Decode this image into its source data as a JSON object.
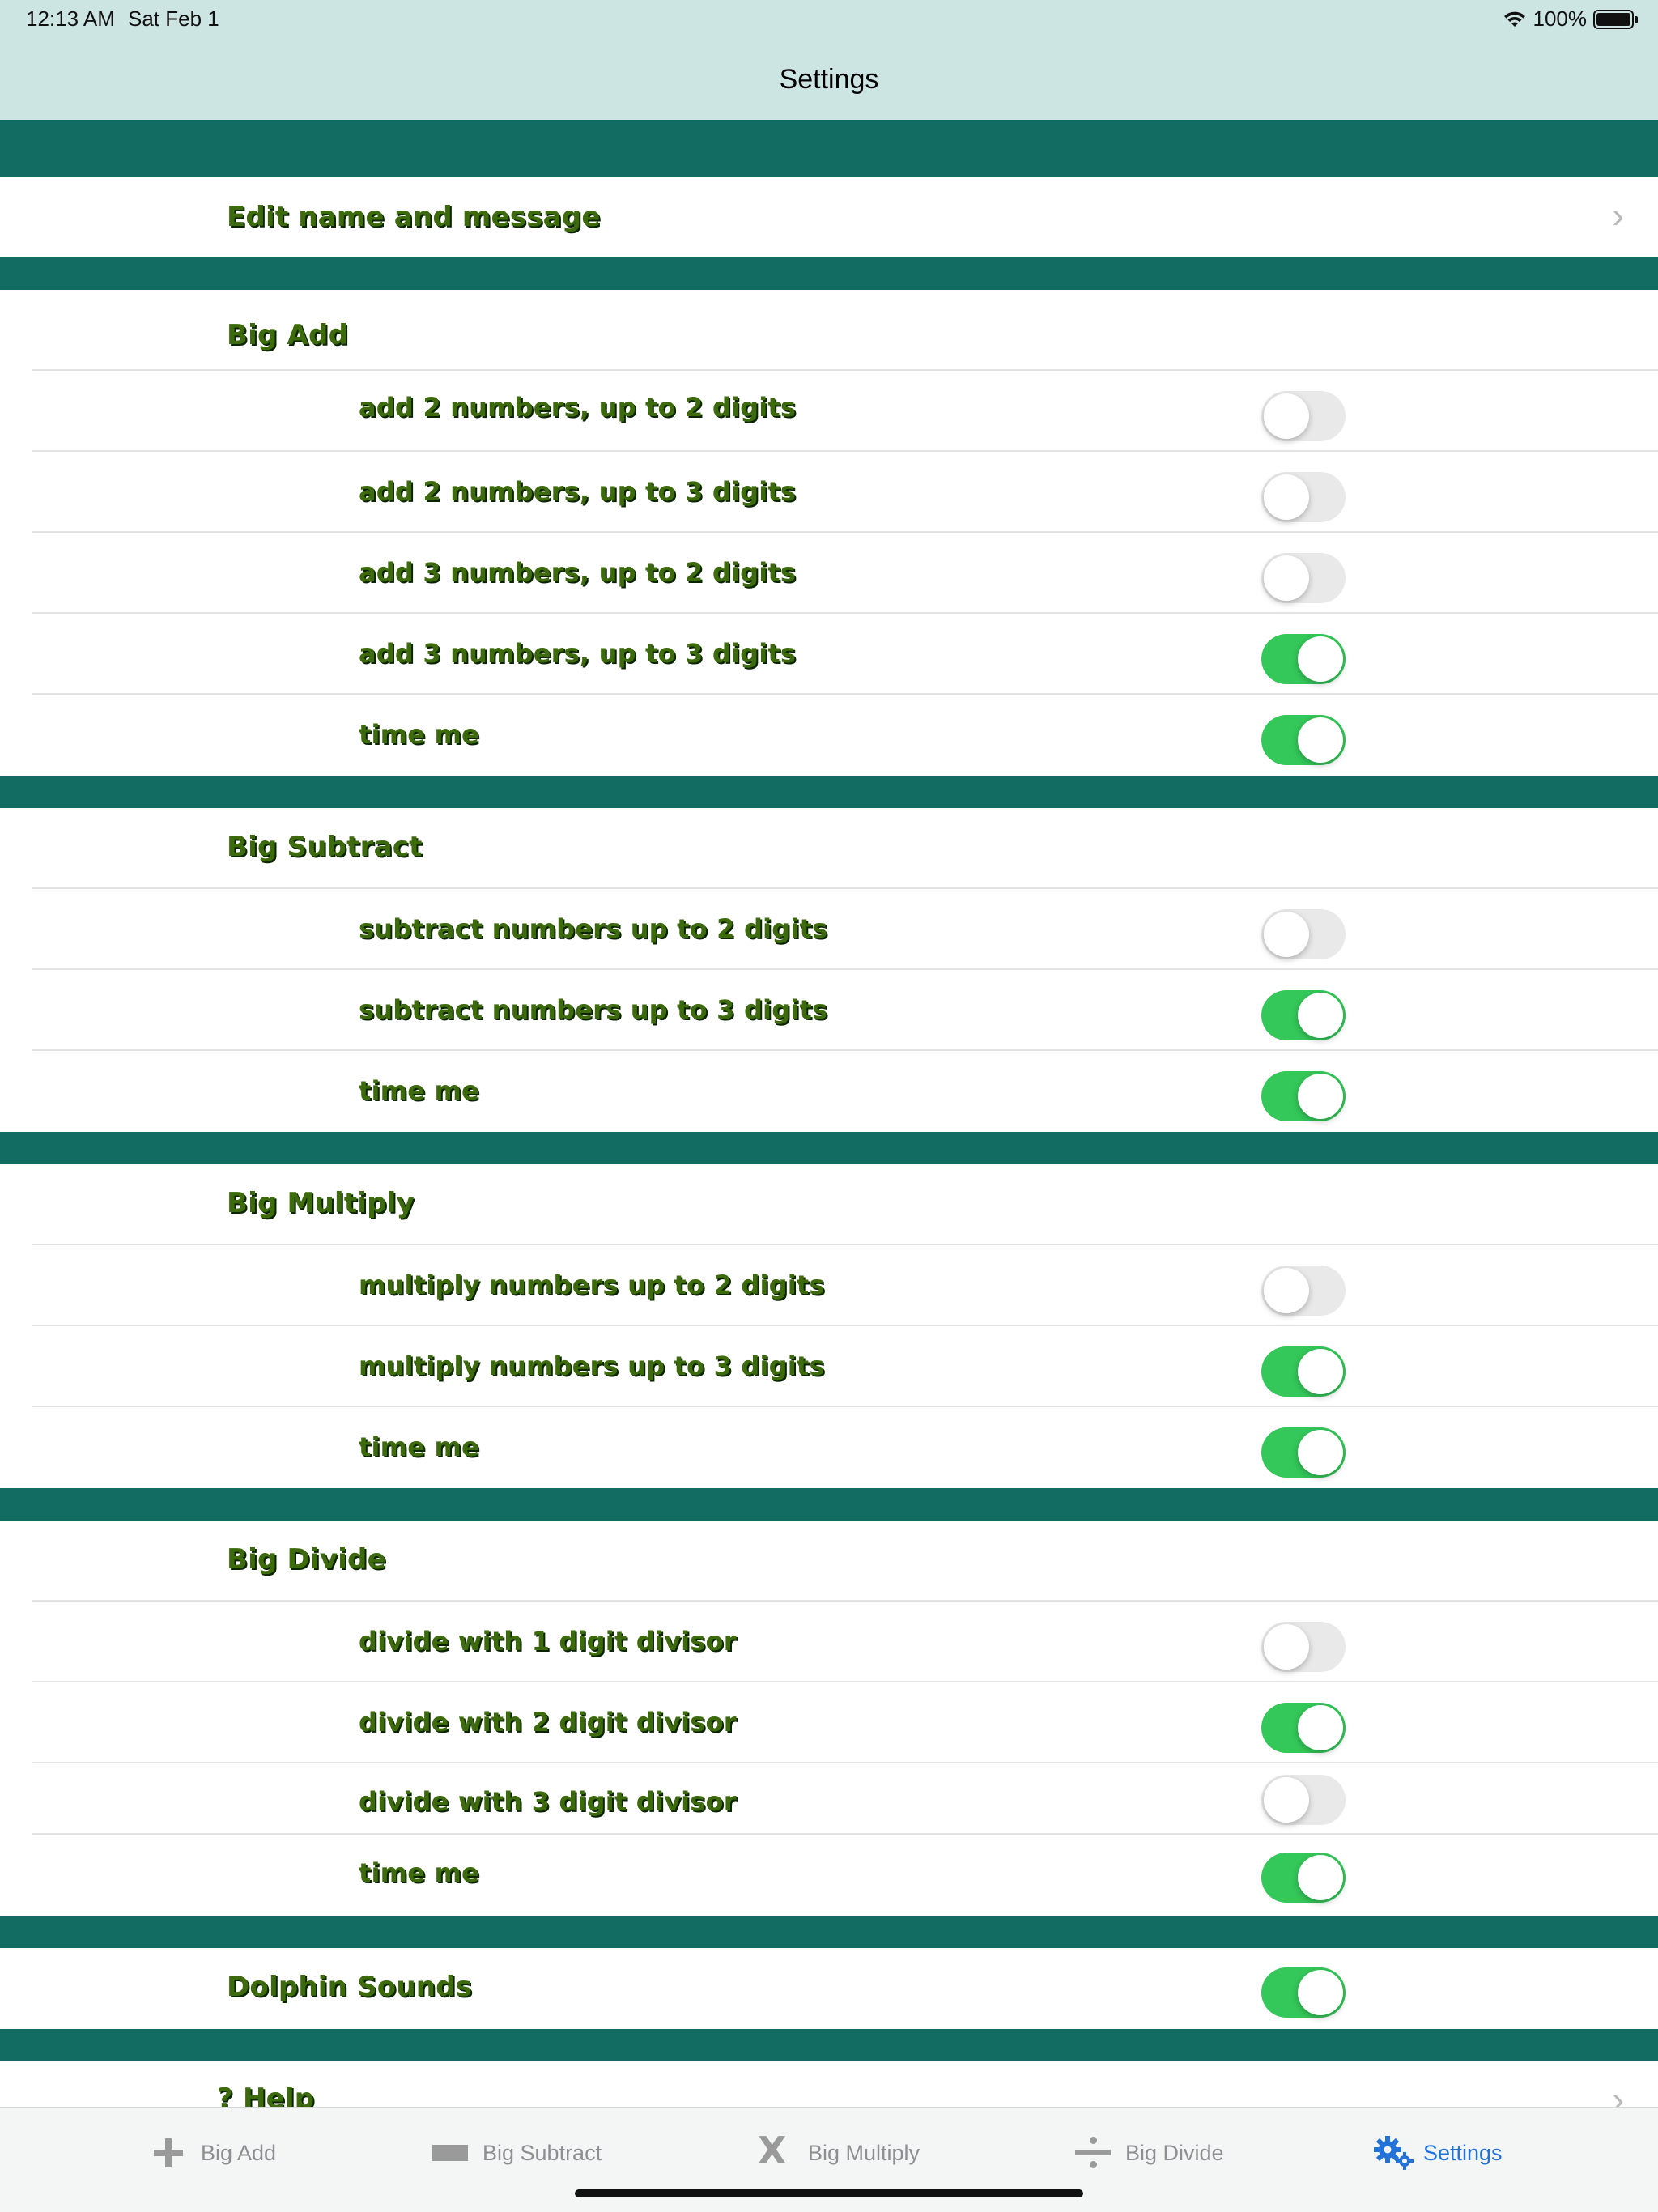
{
  "status_bar": {
    "time": "12:13 AM",
    "date": "Sat Feb 1",
    "battery": "100%"
  },
  "nav": {
    "title": "Settings"
  },
  "edit_row": {
    "label": "Edit name and message"
  },
  "sections": [
    {
      "title": "Big Add",
      "items": [
        {
          "label": "add 2 numbers, up to 2 digits",
          "on": false
        },
        {
          "label": "add 2 numbers, up to 3 digits",
          "on": false
        },
        {
          "label": "add 3 numbers, up to 2 digits",
          "on": false
        },
        {
          "label": "add 3 numbers, up to 3 digits",
          "on": true
        },
        {
          "label": "time me",
          "on": true
        }
      ]
    },
    {
      "title": "Big Subtract",
      "items": [
        {
          "label": "subtract numbers up to 2 digits",
          "on": false
        },
        {
          "label": "subtract numbers up to 3 digits",
          "on": true
        },
        {
          "label": "time me",
          "on": true
        }
      ]
    },
    {
      "title": "Big Multiply",
      "items": [
        {
          "label": "multiply numbers up to 2 digits",
          "on": false
        },
        {
          "label": "multiply numbers up to 3 digits",
          "on": true
        },
        {
          "label": "time me",
          "on": true
        }
      ]
    },
    {
      "title": "Big Divide",
      "items": [
        {
          "label": "divide with 1 digit divisor",
          "on": false
        },
        {
          "label": "divide with 2 digit divisor",
          "on": true
        },
        {
          "label": "divide with 3 digit divisor",
          "on": false
        },
        {
          "label": "time me",
          "on": true
        }
      ]
    }
  ],
  "dolphin": {
    "label": "Dolphin Sounds",
    "on": true
  },
  "help": {
    "label": "? Help"
  },
  "tabs": [
    {
      "label": "Big Add",
      "icon": "plus-icon",
      "active": false
    },
    {
      "label": "Big Subtract",
      "icon": "minus-icon",
      "active": false
    },
    {
      "label": "Big Multiply",
      "icon": "multiply-icon",
      "active": false
    },
    {
      "label": "Big Divide",
      "icon": "divide-icon",
      "active": false
    },
    {
      "label": "Settings",
      "icon": "gears-icon",
      "active": true
    }
  ],
  "colors": {
    "band": "#126c62",
    "nav_bg": "#cde5e2",
    "toggle_on": "#34c759",
    "label_green": "#3c6a0c",
    "tab_active": "#2272d8"
  }
}
